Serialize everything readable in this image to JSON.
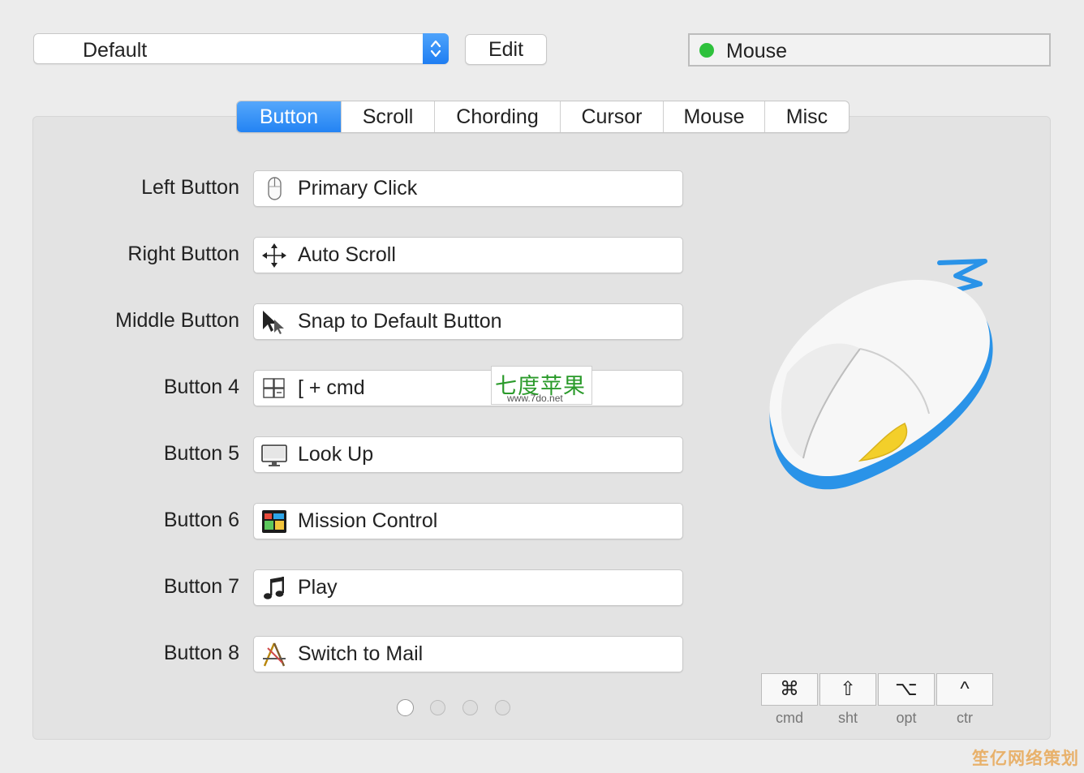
{
  "header": {
    "profile_select": "Default",
    "edit_label": "Edit",
    "device_name": "Mouse",
    "device_status_color": "#2ec13c"
  },
  "tabs": [
    {
      "label": "Button",
      "active": true
    },
    {
      "label": "Scroll",
      "active": false
    },
    {
      "label": "Chording",
      "active": false
    },
    {
      "label": "Cursor",
      "active": false
    },
    {
      "label": "Mouse",
      "active": false
    },
    {
      "label": "Misc",
      "active": false
    }
  ],
  "buttons": [
    {
      "label": "Left Button",
      "action": "Primary Click",
      "icon": "mouse-icon"
    },
    {
      "label": "Right Button",
      "action": "Auto Scroll",
      "icon": "move-arrows-icon"
    },
    {
      "label": "Middle Button",
      "action": "Snap to Default Button",
      "icon": "snap-cursor-icon"
    },
    {
      "label": "Button 4",
      "action": "[ + cmd",
      "icon": "keyboard-shortcut-icon"
    },
    {
      "label": "Button 5",
      "action": "Look Up",
      "icon": "monitor-icon"
    },
    {
      "label": "Button 6",
      "action": "Mission Control",
      "icon": "mission-control-icon"
    },
    {
      "label": "Button 7",
      "action": "Play",
      "icon": "music-note-icon"
    },
    {
      "label": "Button 8",
      "action": "Switch to Mail",
      "icon": "app-store-icon"
    }
  ],
  "pager": {
    "pages": 4,
    "current": 1
  },
  "modifiers": [
    {
      "symbol": "⌘",
      "label": "cmd"
    },
    {
      "symbol": "⇧",
      "label": "sht"
    },
    {
      "symbol": "⌥",
      "label": "opt"
    },
    {
      "symbol": "^",
      "label": "ctr"
    }
  ],
  "watermarks": {
    "center_cn": "七度苹果",
    "center_url": "www.7do.net",
    "corner": "笙亿网络策划"
  },
  "colors": {
    "accent": "#2383f3",
    "mouse_trim": "#2a93e8",
    "mouse_button": "#f3cf2a"
  }
}
